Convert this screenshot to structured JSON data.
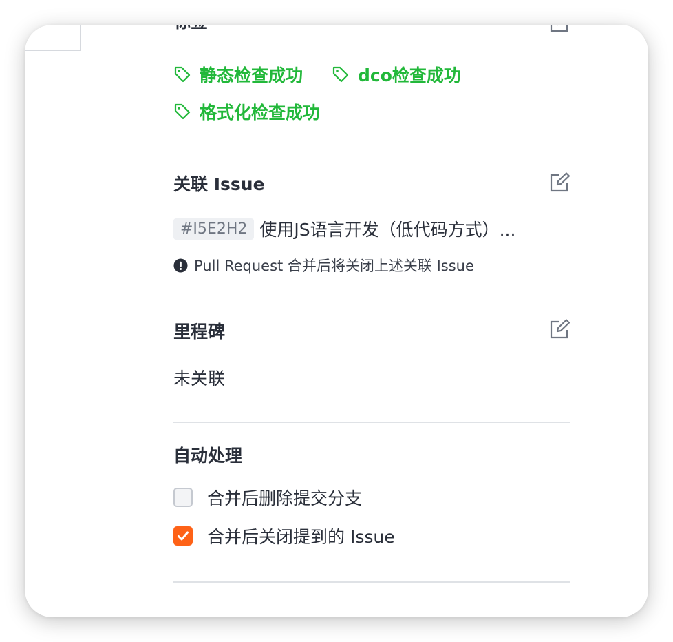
{
  "labels_section": {
    "title_partial": "标签",
    "tags": [
      {
        "label": "静态检查成功"
      },
      {
        "label": "dco检查成功"
      },
      {
        "label": "格式化检查成功"
      }
    ],
    "tag_color": "#22b83a"
  },
  "linked_issue": {
    "title": "关联 Issue",
    "issue_id": "#I5E2H2",
    "issue_title": "使用JS语言开发（低代码方式）...",
    "notice": "Pull Request 合并后将关闭上述关联 Issue"
  },
  "milestone": {
    "title": "里程碑",
    "value": "未关联"
  },
  "auto_process": {
    "title": "自动处理",
    "options": [
      {
        "label": "合并后删除提交分支",
        "checked": false
      },
      {
        "label": "合并后关闭提到的 Issue",
        "checked": true
      }
    ],
    "accent_color": "#fe6217"
  }
}
